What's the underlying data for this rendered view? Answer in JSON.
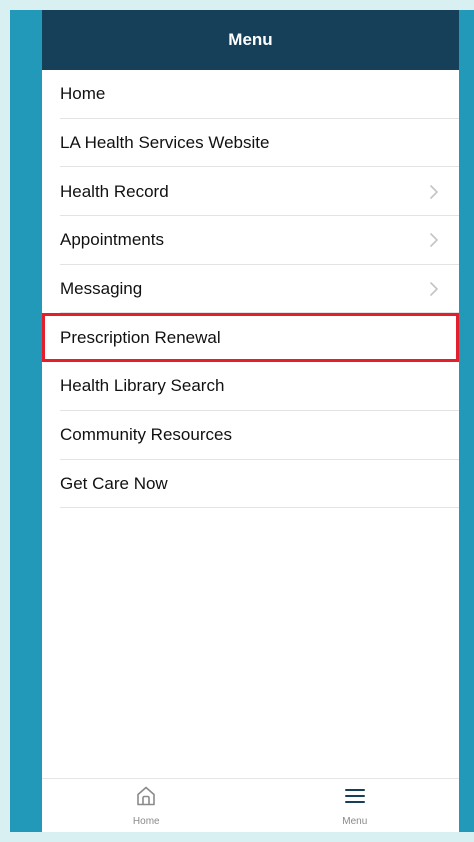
{
  "header": {
    "title": "Menu"
  },
  "menu": {
    "items": [
      {
        "label": "Home",
        "has_chevron": false
      },
      {
        "label": "LA Health Services Website",
        "has_chevron": false
      },
      {
        "label": "Health Record",
        "has_chevron": true
      },
      {
        "label": "Appointments",
        "has_chevron": true
      },
      {
        "label": "Messaging",
        "has_chevron": true
      },
      {
        "label": "Prescription Renewal",
        "has_chevron": false,
        "highlighted": true
      },
      {
        "label": "Health Library Search",
        "has_chevron": false
      },
      {
        "label": "Community Resources",
        "has_chevron": false
      },
      {
        "label": "Get Care Now",
        "has_chevron": false
      }
    ]
  },
  "tabbar": {
    "home": {
      "label": "Home",
      "icon": "home-icon"
    },
    "menu": {
      "label": "Menu",
      "icon": "hamburger-menu-icon"
    }
  },
  "colors": {
    "header_bg": "#163f5a",
    "page_bg": "#d8f0f1",
    "side_strip": "#2299b8",
    "highlight": "#e41e2b"
  }
}
